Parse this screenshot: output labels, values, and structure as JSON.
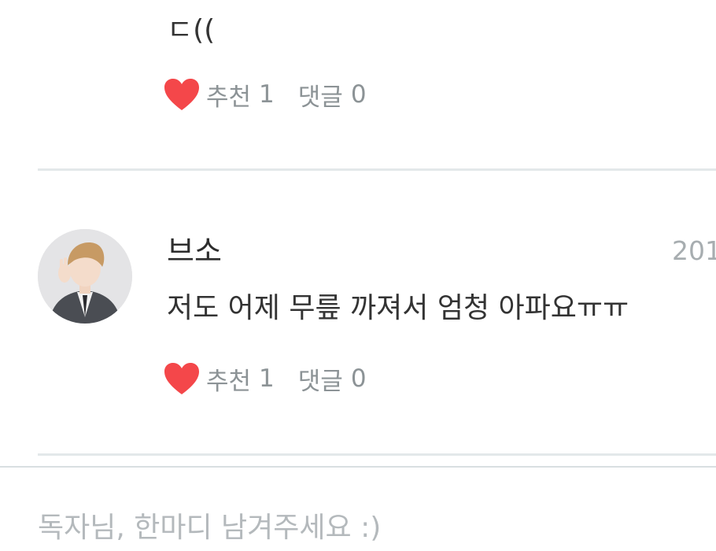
{
  "comments": [
    {
      "text": "ㄷ((",
      "like_label": "추천",
      "like_count": "1",
      "reply_label": "댓글",
      "reply_count": "0",
      "heart_icon": "heart-icon"
    },
    {
      "author": "브소",
      "timestamp": "201",
      "text": "저도 어제 무릎 까져서 엄청 아파요ㅠㅠ",
      "like_label": "추천",
      "like_count": "1",
      "reply_label": "댓글",
      "reply_count": "0",
      "heart_icon": "heart-icon"
    }
  ],
  "comment_input": {
    "placeholder": "독자님, 한마디 남겨주세요 :)"
  },
  "colors": {
    "heart": "#f4474a",
    "meta_text": "#8c9396",
    "body_text": "#333333",
    "divider": "#e3e8ea"
  }
}
